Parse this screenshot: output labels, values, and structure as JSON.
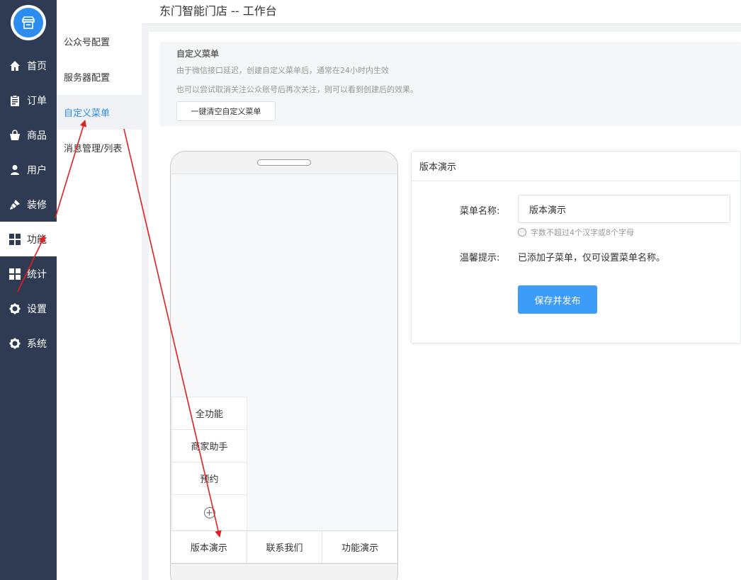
{
  "header": {
    "title": "东门智能门店 -- 工作台"
  },
  "sidebar": {
    "items": [
      {
        "label": "首页",
        "icon": "home-icon"
      },
      {
        "label": "订单",
        "icon": "clipboard-icon"
      },
      {
        "label": "商品",
        "icon": "shopping-bag-icon"
      },
      {
        "label": "用户",
        "icon": "user-icon"
      },
      {
        "label": "装修",
        "icon": "brush-icon"
      },
      {
        "label": "功能",
        "icon": "grid-icon",
        "active": true
      },
      {
        "label": "统计",
        "icon": "grid-icon"
      },
      {
        "label": "设置",
        "icon": "gear-icon"
      },
      {
        "label": "系统",
        "icon": "gear-icon"
      }
    ]
  },
  "subnav": {
    "items": [
      {
        "label": "公众号配置"
      },
      {
        "label": "服务器配置"
      },
      {
        "label": "自定义菜单",
        "active": true
      },
      {
        "label": "消息管理/列表"
      }
    ]
  },
  "notice": {
    "title": "自定义菜单",
    "line1": "由于微信接口延迟，创建自定义菜单后，通常在24小时内生效",
    "line2": "也可以尝试取消关注公众账号后再次关注，则可以看到创建后的效果。",
    "clear_button": "一键清空自定义菜单"
  },
  "phone": {
    "submenu": [
      "全功能",
      "商家助手",
      "预约"
    ],
    "add_symbol": "+",
    "bottom_menu": [
      "版本演示",
      "联系我们",
      "功能演示"
    ]
  },
  "panel": {
    "title": "版本演示",
    "menu_name_label": "菜单名称:",
    "menu_name_value": "版本演示",
    "hint": "字数不超过4个汉字或8个字母",
    "tip_label": "温馨提示:",
    "tip_text": "已添加子菜单，仅可设置菜单名称。",
    "save_button": "保存并发布"
  },
  "colors": {
    "sidebar_bg": "#2f3b52",
    "accent": "#2d8cf0",
    "save_button": "#3c9cf8",
    "annotation": "#e02020"
  }
}
